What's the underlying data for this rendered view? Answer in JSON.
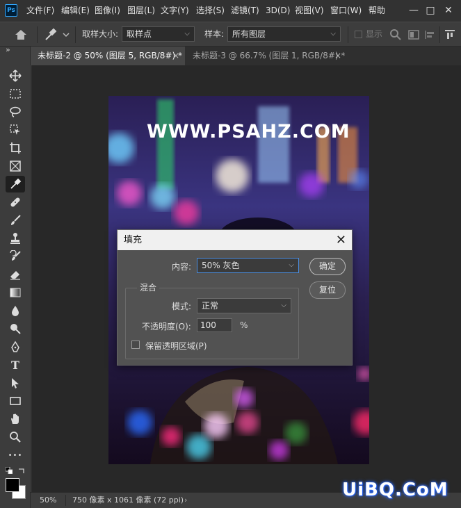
{
  "app": {
    "logo": "Ps"
  },
  "menu": [
    "文件(F)",
    "编辑(E)",
    "图像(I)",
    "图层(L)",
    "文字(Y)",
    "选择(S)",
    "滤镜(T)",
    "3D(D)",
    "视图(V)",
    "窗口(W)",
    "帮助"
  ],
  "window_controls": {
    "minimize": "—",
    "maximize": "□",
    "close": "✕"
  },
  "options": {
    "sample_size_label": "取样大小:",
    "sample_size_value": "取样点",
    "sample_label": "样本:",
    "sample_value": "所有图层",
    "show_ring_label": "显示",
    "expand": "»"
  },
  "tabs": [
    {
      "label": "未标题-2 @ 50% (图层 5, RGB/8#) *",
      "close": "×",
      "active": true
    },
    {
      "label": "未标题-3 @ 66.7% (图层 1, RGB/8#) *",
      "close": "×",
      "active": false
    }
  ],
  "toolbar_expand": "»",
  "tools": [
    "move-icon",
    "marquee-icon",
    "lasso-icon",
    "object-select-icon",
    "crop-icon",
    "frame-icon",
    "eyedropper-icon",
    "healing-icon",
    "brush-icon",
    "stamp-icon",
    "history-brush-icon",
    "eraser-icon",
    "gradient-icon",
    "blur-icon",
    "dodge-icon",
    "pen-icon",
    "type-icon",
    "path-select-icon",
    "rectangle-icon",
    "hand-icon",
    "zoom-icon",
    "more-icon"
  ],
  "type_tool_glyph": "T",
  "more_glyph": "•••",
  "canvas": {
    "watermark_text": "WWW.PSAHZ.COM"
  },
  "status": {
    "zoom": "50%",
    "doc_info": "750 像素 x 1061 像素 (72 ppi)",
    "arrow": "›"
  },
  "dialog": {
    "title": "填充",
    "close": "✕",
    "content_label": "内容:",
    "content_value": "50% 灰色",
    "ok": "确定",
    "reset": "复位",
    "blend_group": "混合",
    "mode_label": "模式:",
    "mode_value": "正常",
    "opacity_label": "不透明度(O):",
    "opacity_value": "100",
    "opacity_unit": "%",
    "preserve_label": "保留透明区域(P)",
    "preserve_checked": false
  },
  "site_watermark": "UiBQ.CoM",
  "colors": {
    "accent": "#31a8ff",
    "panel": "#535353",
    "canvas": "#282828"
  }
}
